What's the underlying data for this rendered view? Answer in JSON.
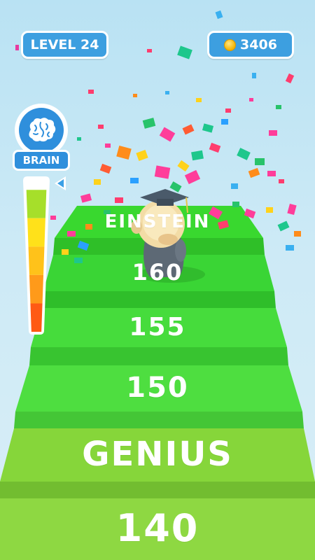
{
  "hud": {
    "level_label": "LEVEL 24",
    "coins": "3406",
    "coin_icon": "coin-icon",
    "colors": {
      "pill": "#3d9fe0",
      "border": "#ffffff"
    }
  },
  "brain_meter": {
    "label": "BRAIN",
    "icon": "brain-icon",
    "fill_fraction": 0.93,
    "segment_colors": [
      "#a6df2a",
      "#ffe11a",
      "#ffc21a",
      "#ff9a1a",
      "#ff5a14"
    ]
  },
  "steps": [
    {
      "label": "EINSTEIN",
      "color": "#39d82f"
    },
    {
      "label": "160",
      "color": "#3ad535"
    },
    {
      "label": "155",
      "color": "#46dc3c"
    },
    {
      "label": "150",
      "color": "#4ede40"
    },
    {
      "label": "GENIUS",
      "color": "#86d63a"
    },
    {
      "label": "140",
      "color": "#8ed842"
    }
  ],
  "character": {
    "name": "graduate-character",
    "hat_color": "#4a5a6a",
    "gown_color": "#5d6975"
  }
}
